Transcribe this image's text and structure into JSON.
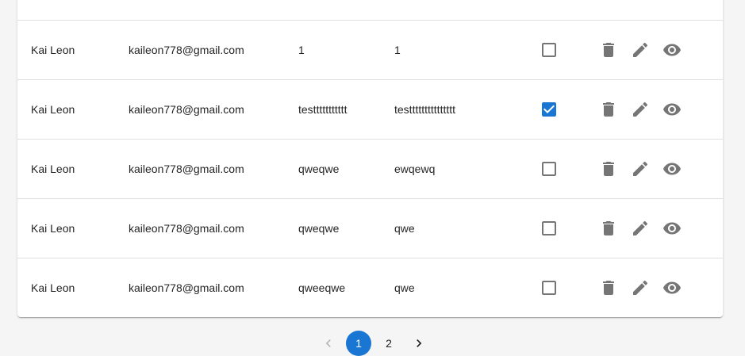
{
  "table": {
    "rows": [
      {
        "name": "Kai Leon",
        "email": "kaileon778@gmail.com",
        "field1": "1",
        "field2": "1",
        "checked": false
      },
      {
        "name": "Kai Leon",
        "email": "kaileon778@gmail.com",
        "field1": "testtttttttttt",
        "field2": "testtttttttttttttt",
        "checked": true
      },
      {
        "name": "Kai Leon",
        "email": "kaileon778@gmail.com",
        "field1": "qweqwe",
        "field2": "ewqewq",
        "checked": false
      },
      {
        "name": "Kai Leon",
        "email": "kaileon778@gmail.com",
        "field1": "qweqwe",
        "field2": "qwe",
        "checked": false
      },
      {
        "name": "Kai Leon",
        "email": "kaileon778@gmail.com",
        "field1": "qweeqwe",
        "field2": "qwe",
        "checked": false
      }
    ],
    "icons": [
      "delete-icon",
      "edit-icon",
      "visibility-icon"
    ]
  },
  "pagination": {
    "pages": [
      "1",
      "2"
    ],
    "current": "1",
    "prev_icon": "chevron-left-icon",
    "next_icon": "chevron-right-icon"
  },
  "colors": {
    "accent": "#1976d2",
    "icon": "#757575",
    "checkbox_border": "#757575",
    "divider": "#e0e0e0"
  }
}
